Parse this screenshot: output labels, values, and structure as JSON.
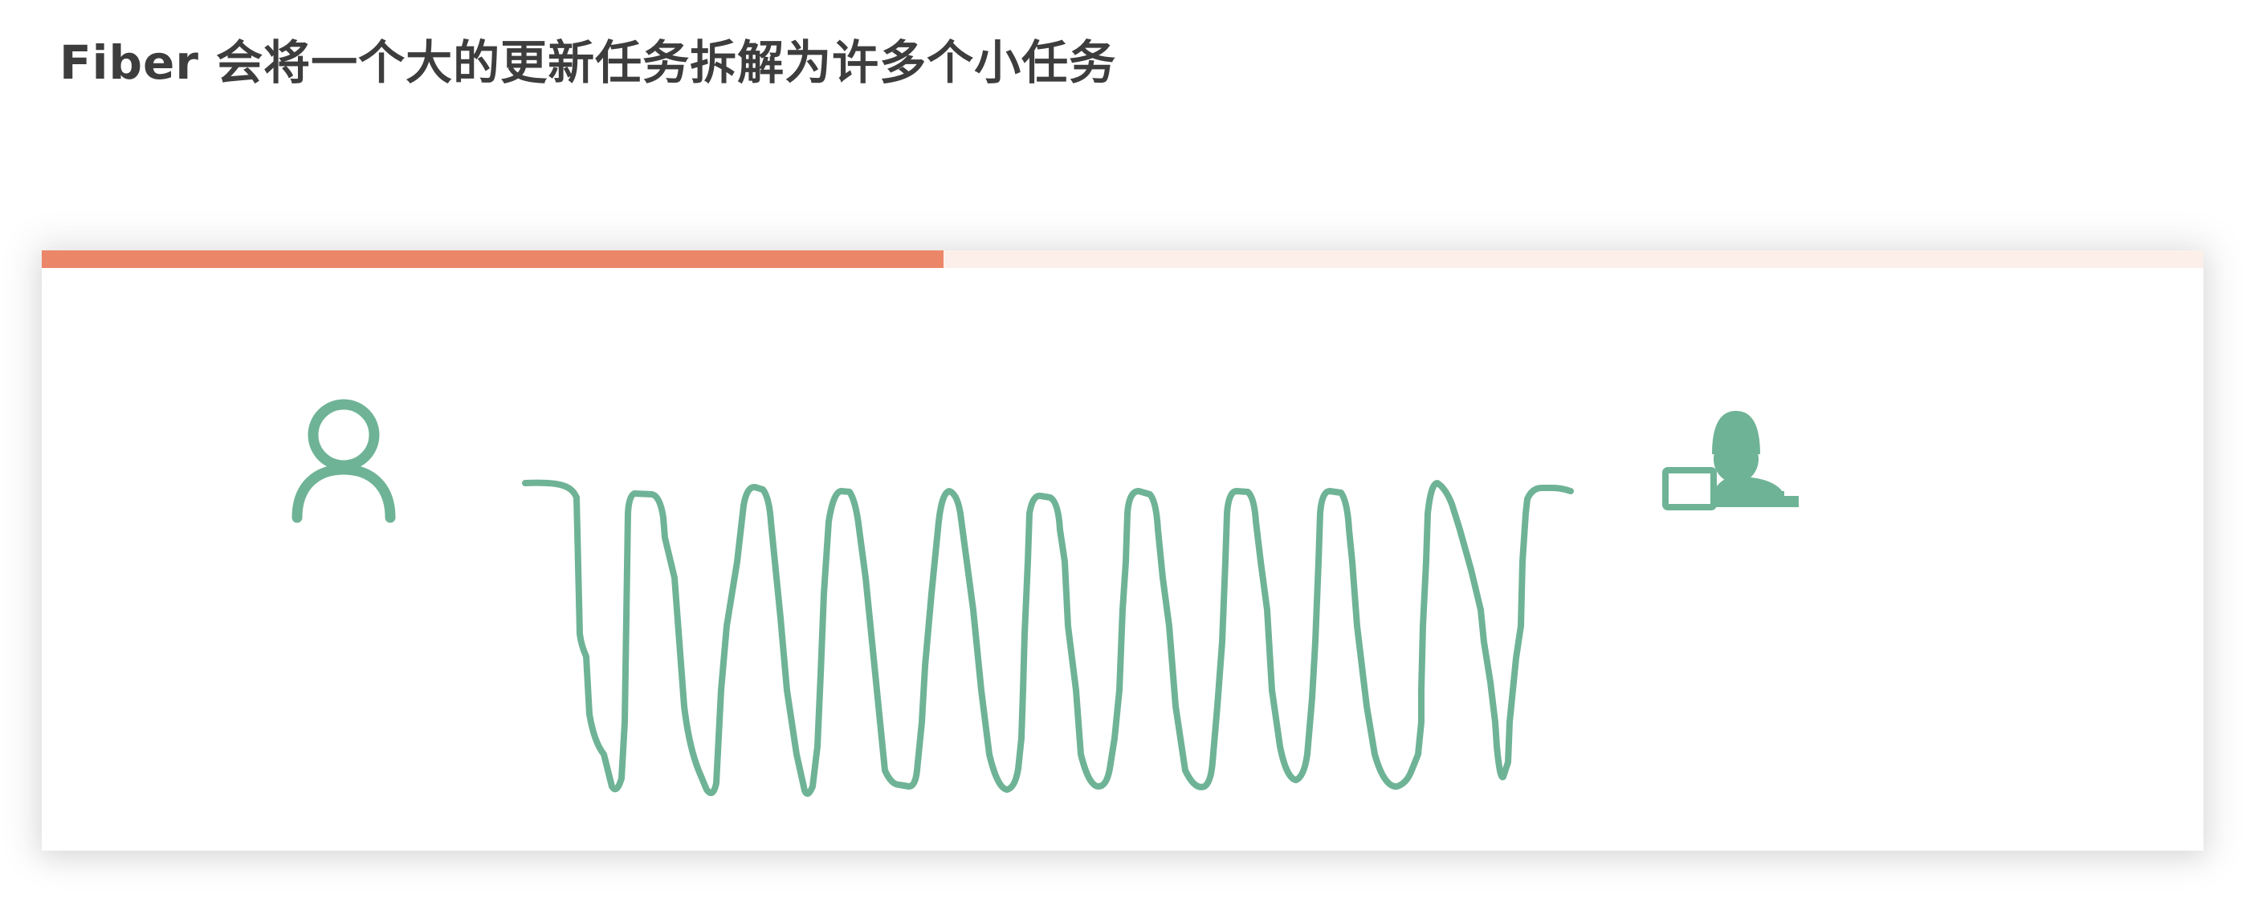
{
  "page": {
    "title": "Fiber 会将一个大的更新任务拆解为许多个小任务"
  },
  "progress": {
    "value": 0.417,
    "fill_color": "#ec8669",
    "track_color": "#fcefe9"
  },
  "diagram": {
    "accent_color": "#6fb396",
    "icons": [
      "user-icon",
      "worker-laptop-icon"
    ],
    "connector": "squiggle-line"
  }
}
